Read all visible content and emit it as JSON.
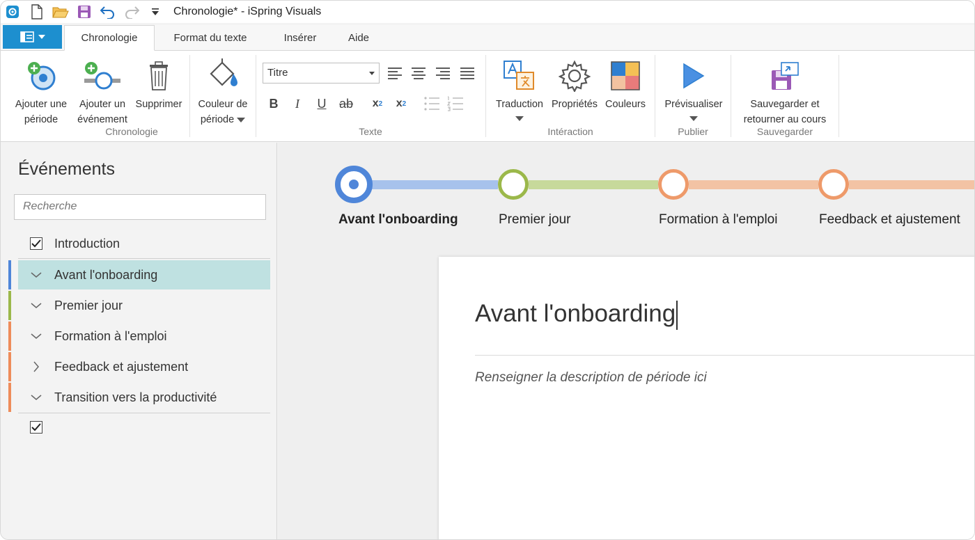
{
  "titlebar": {
    "title": "Chronologie* - iSpring Visuals",
    "icons": [
      "app-icon",
      "new-file-icon",
      "open-folder-icon",
      "save-icon",
      "undo-icon",
      "redo-icon",
      "customize-qat-icon"
    ]
  },
  "tabs": [
    {
      "label": "Chronologie",
      "active": true
    },
    {
      "label": "Format du texte",
      "active": false
    },
    {
      "label": "Insérer",
      "active": false
    },
    {
      "label": "Aide",
      "active": false
    }
  ],
  "ribbon": {
    "chronologie": {
      "group_label": "Chronologie",
      "add_period": "Ajouter une période",
      "add_period_l1": "Ajouter une",
      "add_period_l2": "période",
      "add_event_l1": "Ajouter un",
      "add_event_l2": "événement",
      "delete": "Supprimer",
      "color_l1": "Couleur de",
      "color_l2": "période"
    },
    "texte": {
      "group_label": "Texte",
      "style_value": "Titre",
      "bold": "B",
      "italic": "I",
      "underline": "U",
      "strike": "ab",
      "subscript": "x",
      "subscript_index": "2",
      "superscript": "x",
      "superscript_index": "2"
    },
    "interaction": {
      "group_label": "Intéraction",
      "translation": "Traduction",
      "properties": "Propriétés",
      "colors": "Couleurs"
    },
    "publier": {
      "group_label": "Publier",
      "preview": "Prévisualiser"
    },
    "sauvegarder": {
      "group_label": "Sauvegarder",
      "save_l1": "Sauvegarder et",
      "save_l2": "retourner au cours"
    }
  },
  "sidebar": {
    "title": "Événements",
    "search_placeholder": "Recherche",
    "items": [
      {
        "label": "Introduction",
        "kind": "checkbox",
        "checked": true
      },
      {
        "label": "Avant l'onboarding",
        "kind": "period",
        "expanded": true,
        "selected": true,
        "color": "#4f86d9"
      },
      {
        "label": "Premier jour",
        "kind": "period",
        "expanded": true,
        "selected": false,
        "color": "#9bb84a"
      },
      {
        "label": "Formation à l'emploi",
        "kind": "period",
        "expanded": true,
        "selected": false,
        "color": "#ee8c5a"
      },
      {
        "label": "Feedback et ajustement",
        "kind": "period",
        "expanded": false,
        "selected": false,
        "color": "#ee8c5a"
      },
      {
        "label": "Transition vers la productivité",
        "kind": "period",
        "expanded": true,
        "selected": false,
        "color": "#ee8c5a"
      },
      {
        "label": "",
        "kind": "checkbox",
        "checked": true
      }
    ]
  },
  "timeline": {
    "periods": [
      {
        "label": "Avant l'onboarding",
        "color": "#4f86d9",
        "bar_color": "#a7c2ec",
        "selected": true
      },
      {
        "label": "Premier jour",
        "color": "#9bb84a",
        "bar_color": "#c7d99b",
        "selected": false
      },
      {
        "label": "Formation à l'emploi",
        "color": "#ee9a6a",
        "bar_color": "#f3c3a4",
        "selected": false
      },
      {
        "label": "Feedback et ajustement",
        "color": "#ee9a6a",
        "bar_color": "#f3c3a4",
        "selected": false
      }
    ]
  },
  "card": {
    "title": "Avant l'onboarding",
    "description": "Renseigner la description de période ici"
  }
}
